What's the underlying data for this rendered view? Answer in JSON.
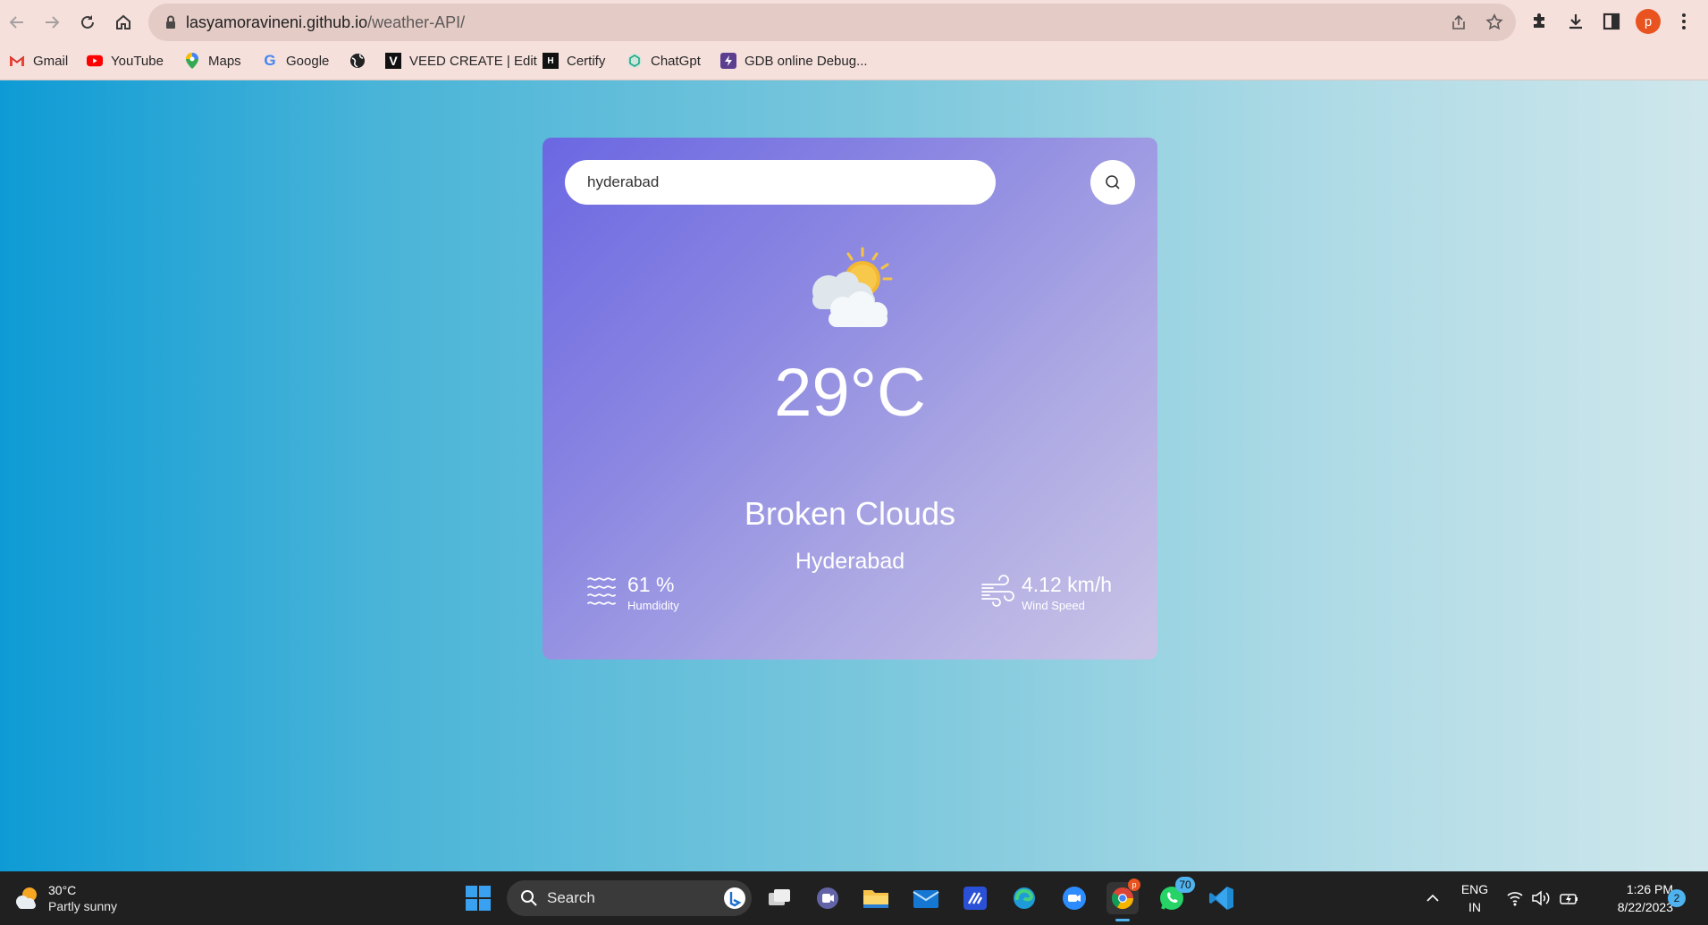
{
  "browser": {
    "url_host": "lasyamoravineni.github.io",
    "url_path": "/weather-API/",
    "profile_initial": "p",
    "bookmarks": [
      {
        "label": "Gmail",
        "icon": "gmail-icon"
      },
      {
        "label": "YouTube",
        "icon": "youtube-icon"
      },
      {
        "label": "Maps",
        "icon": "maps-icon"
      },
      {
        "label": "Google",
        "icon": "google-icon"
      },
      {
        "label": "",
        "icon": "globe-icon"
      },
      {
        "label": "VEED CREATE | Edit",
        "icon": "veed-icon"
      },
      {
        "label": "Certify",
        "icon": "certify-icon"
      },
      {
        "label": "ChatGpt",
        "icon": "chatgpt-icon"
      },
      {
        "label": "GDB online Debug...",
        "icon": "gdb-icon"
      }
    ]
  },
  "weather": {
    "search_value": "hyderabad",
    "temperature": "29°C",
    "description": "Broken Clouds",
    "city": "Hyderabad",
    "humidity_value": "61 %",
    "humidity_label": "Humdidity",
    "wind_value": "4.12 km/h",
    "wind_label": "Wind Speed",
    "icon": "partly-cloudy-icon"
  },
  "taskbar": {
    "weather_temp": "30°C",
    "weather_desc": "Partly sunny",
    "search_label": "Search",
    "whatsapp_badge": "70",
    "lang_line1": "ENG",
    "lang_line2": "IN",
    "time": "1:26 PM",
    "date": "8/22/2023",
    "notification_count": "2"
  },
  "colors": {
    "card_gradient_start": "#6b67e2",
    "card_gradient_end": "#c9c4e6",
    "page_gradient_start": "#0e9bd5",
    "page_gradient_end": "#cfe7ec"
  }
}
